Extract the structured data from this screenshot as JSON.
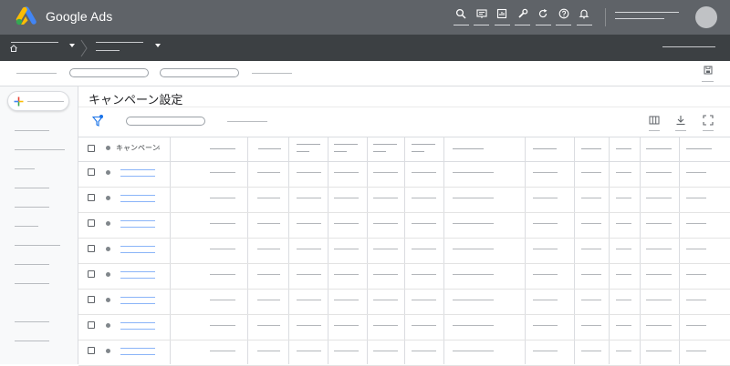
{
  "app": {
    "brand_name": "Google Ads",
    "logo_colors": {
      "blue": "#4285f4",
      "yellow": "#fbbc04",
      "green": "#34a853"
    }
  },
  "topbar": {
    "background": "#5f6368",
    "icons": [
      "search-icon",
      "preview-icon",
      "reports-icon",
      "tools-icon",
      "refresh-icon",
      "help-icon",
      "notifications-icon"
    ]
  },
  "breadcrumb": {
    "background": "#3c4043",
    "icons": [
      "home-icon",
      "chevron-right-icon"
    ]
  },
  "sidebar": {
    "background": "#f8f9fa",
    "new_button_icon": "plus-icon"
  },
  "main": {
    "page_title": "キャンペーン設定",
    "toolbar_icons": [
      "filter-icon",
      "columns-icon",
      "download-icon",
      "expand-icon"
    ],
    "accent": "#1a73e8"
  },
  "table": {
    "first_column_header": "キャンペーン",
    "sort_indicator": "↓",
    "link_color": "#8ab4f8"
  }
}
